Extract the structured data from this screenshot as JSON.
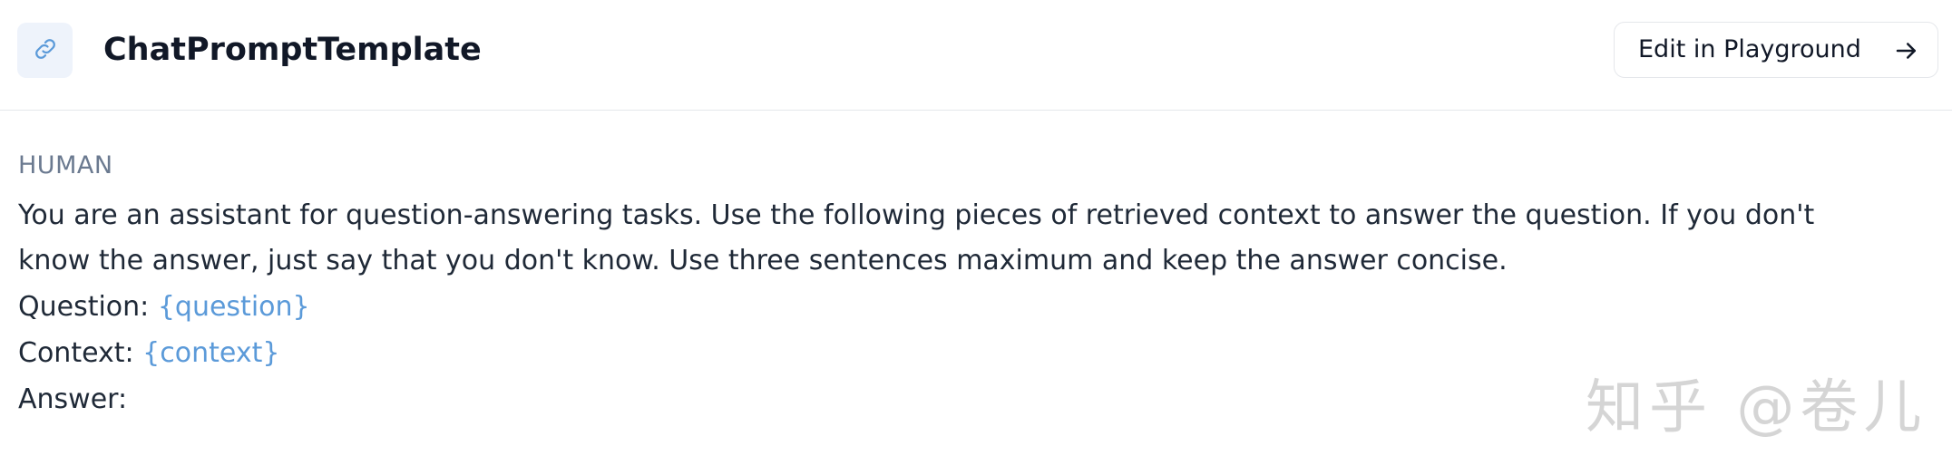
{
  "header": {
    "title": "ChatPromptTemplate",
    "icon": "link-icon",
    "edit_button_label": "Edit in Playground",
    "edit_button_icon": "arrow-right-icon"
  },
  "message": {
    "role": "HUMAN",
    "instruction_line_1": "You are an assistant for question-answering tasks. Use the following pieces of retrieved context to answer the question. If you don't",
    "instruction_line_2": "know the answer, just say that you don't know. Use three sentences maximum and keep the answer concise.",
    "question_label": "Question: ",
    "question_variable": "{question}",
    "context_label": "Context: ",
    "context_variable": "{context}",
    "answer_label": "Answer:"
  },
  "watermark": {
    "text": "知乎 @卷儿"
  },
  "colors": {
    "variable": "#5b9ad9",
    "role_label": "#6b7a90",
    "icon_bg": "#eef3fb",
    "border": "#e5e7eb"
  }
}
